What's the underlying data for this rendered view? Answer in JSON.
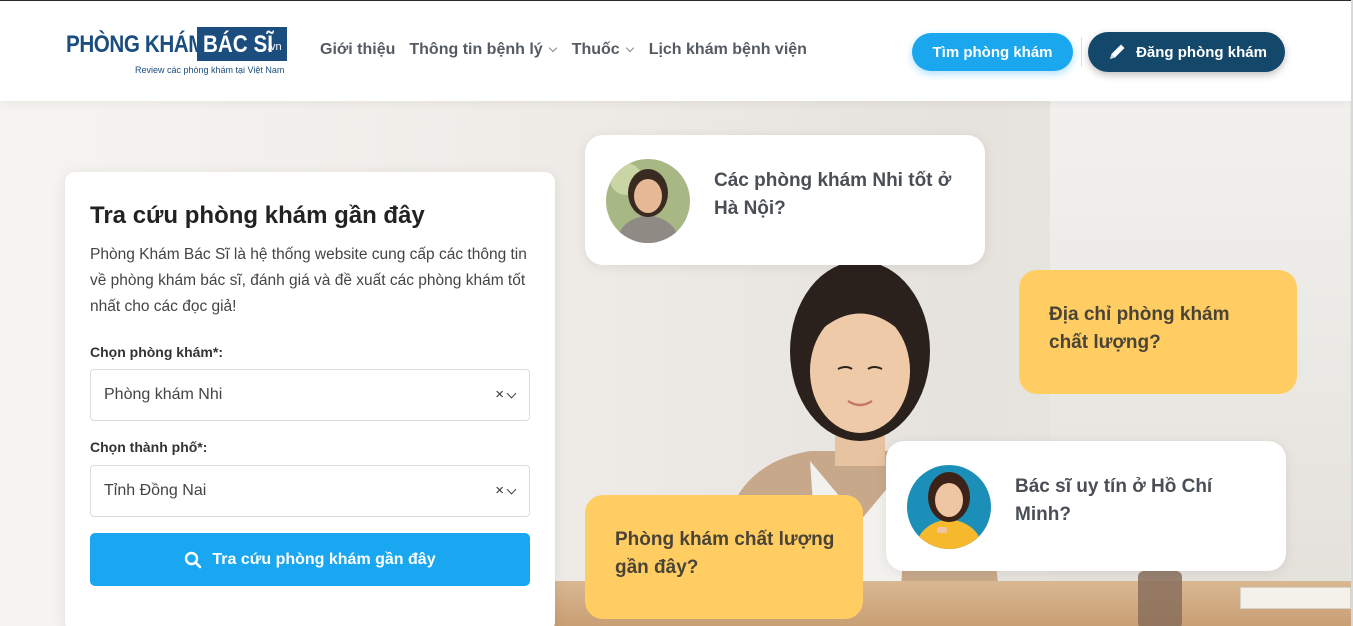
{
  "header": {
    "logo": {
      "main": "PHÒNG KHÁM",
      "box": "BÁC SĨ",
      "suffix": ".vn",
      "tagline": "Review các phòng khám tại Việt Nam"
    },
    "nav": [
      {
        "label": "Giới thiệu",
        "has_dropdown": false
      },
      {
        "label": "Thông tin bệnh lý",
        "has_dropdown": true
      },
      {
        "label": "Thuốc",
        "has_dropdown": true
      },
      {
        "label": "Lịch khám bệnh viện",
        "has_dropdown": false
      }
    ],
    "find_button": "Tìm phòng khám",
    "register_button": "Đăng phòng khám",
    "register_icon": "pencil-icon"
  },
  "search_card": {
    "title": "Tra cứu phòng khám gần đây",
    "description": "Phòng Khám Bác Sĩ là hệ thống website cung cấp các thông tin về phòng khám bác sĩ, đánh giá và đề xuất các phòng khám tốt nhất cho các đọc giả!",
    "clinic_label": "Chọn phòng khám*:",
    "clinic_value": "Phòng khám Nhi",
    "city_label": "Chọn thành phố*:",
    "city_value": "Tỉnh Đồng Nai",
    "clear_symbol": "×",
    "search_button": "Tra cứu phòng khám gần đây",
    "search_icon": "search-icon"
  },
  "bubbles": [
    {
      "text": "Các phòng khám Nhi tốt ở Hà Nội?",
      "style": "white",
      "has_avatar": true
    },
    {
      "text": "Địa chỉ phòng khám chất lượng?",
      "style": "yellow",
      "has_avatar": false
    },
    {
      "text": "Bác sĩ uy tín ở Hồ Chí Minh?",
      "style": "white",
      "has_avatar": true
    },
    {
      "text": "Phòng khám chất lượng gần đây?",
      "style": "yellow",
      "has_avatar": false
    }
  ],
  "colors": {
    "brand_navy": "#1b4d7e",
    "accent_blue": "#1aa7ee",
    "dark_button": "#14486b",
    "bubble_yellow": "#ffcd62"
  }
}
